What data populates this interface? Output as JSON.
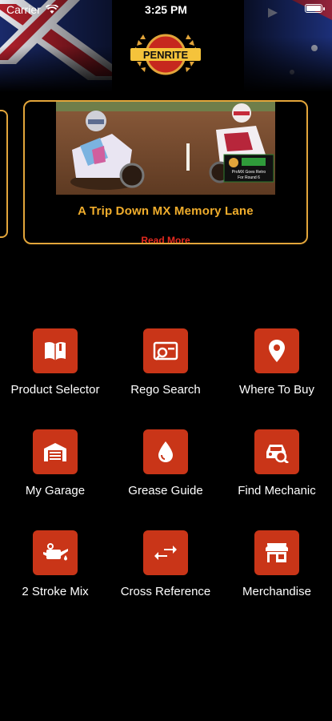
{
  "status_bar": {
    "carrier": "Carrier",
    "time": "3:25 PM"
  },
  "header": {
    "logo_text": "PENRITE"
  },
  "featured": {
    "title": "A Trip Down MX Memory Lane",
    "link": "Read More",
    "badge_line1": "ProMX Goes Retro",
    "badge_line2": "For Round 6"
  },
  "menu": [
    {
      "label": "Product Selector",
      "icon": "book-icon"
    },
    {
      "label": "Rego Search",
      "icon": "rego-search-icon"
    },
    {
      "label": "Where To Buy",
      "icon": "location-pin-icon"
    },
    {
      "label": "My Garage",
      "icon": "garage-icon"
    },
    {
      "label": "Grease Guide",
      "icon": "drop-icon"
    },
    {
      "label": "Find Mechanic",
      "icon": "car-search-icon"
    },
    {
      "label": "2 Stroke Mix",
      "icon": "oil-can-icon"
    },
    {
      "label": "Cross Reference",
      "icon": "arrows-exchange-icon"
    },
    {
      "label": "Merchandise",
      "icon": "store-icon"
    }
  ],
  "colors": {
    "accent": "#c93518",
    "gold": "#e2a53a",
    "link": "#e52a1f"
  }
}
